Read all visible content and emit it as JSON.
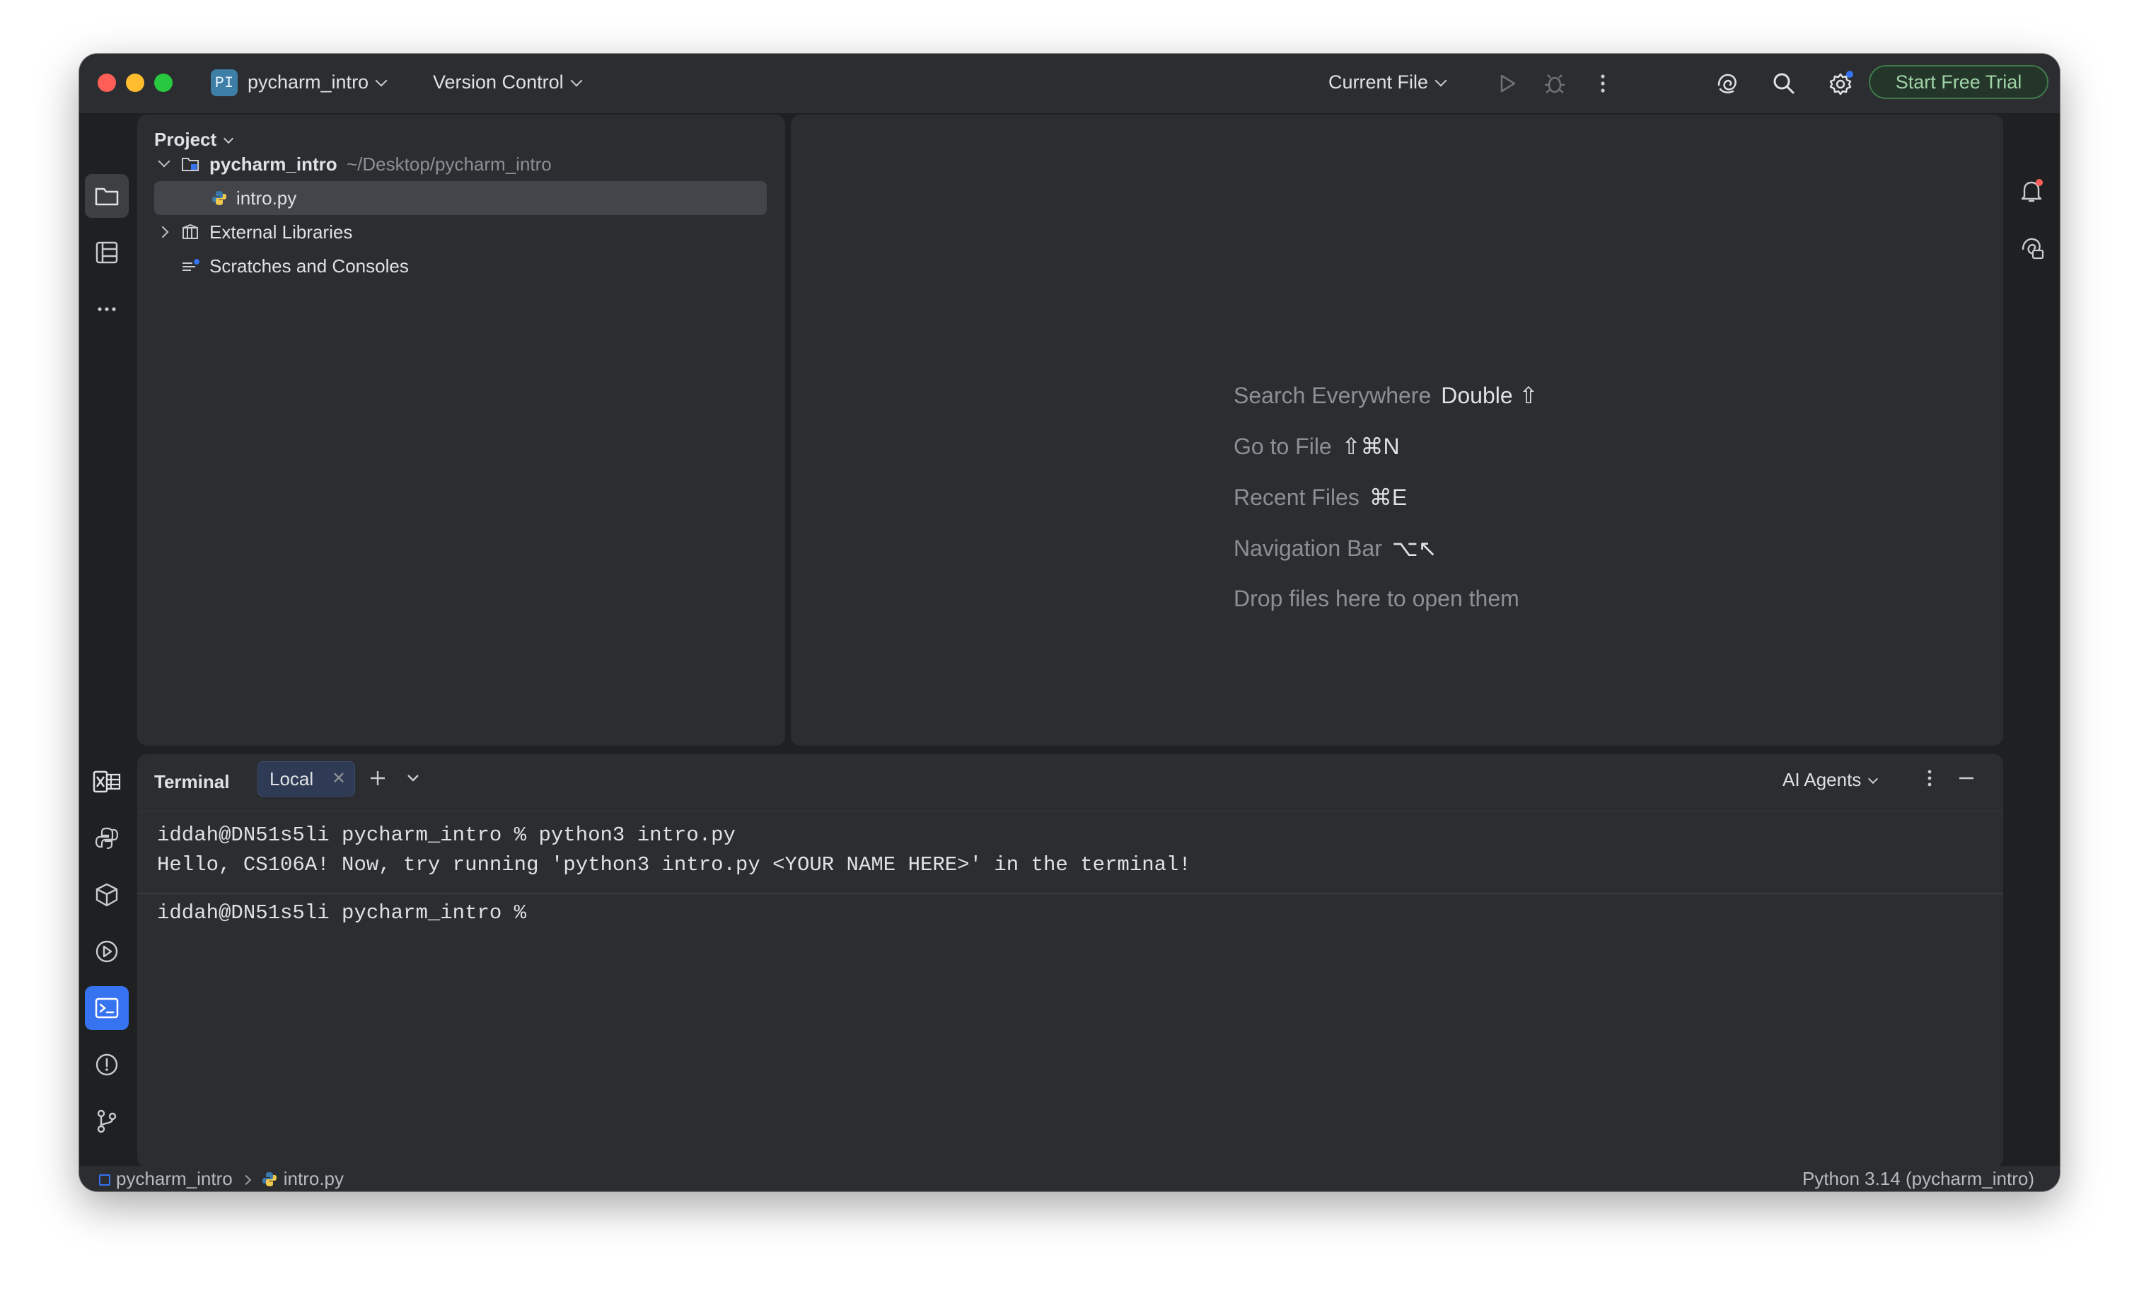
{
  "titlebar": {
    "project_badge": "PI",
    "project_name": "pycharm_intro",
    "vcs_label": "Version Control",
    "run_config": "Current File",
    "trial_button": "Start Free Trial"
  },
  "project_panel": {
    "title": "Project",
    "root": {
      "name": "pycharm_intro",
      "path": "~/Desktop/pycharm_intro"
    },
    "items": [
      {
        "label": "intro.py"
      },
      {
        "label": "External Libraries"
      },
      {
        "label": "Scratches and Consoles"
      }
    ]
  },
  "editor_hints": [
    {
      "label": "Search Everywhere",
      "shortcut": "Double ⇧"
    },
    {
      "label": "Go to File",
      "shortcut": "⇧⌘N"
    },
    {
      "label": "Recent Files",
      "shortcut": "⌘E"
    },
    {
      "label": "Navigation Bar",
      "shortcut": "⌥↖"
    },
    {
      "label": "Drop files here to open them",
      "shortcut": ""
    }
  ],
  "terminal": {
    "title": "Terminal",
    "tab": "Local",
    "ai_agents": "AI Agents",
    "lines": [
      "iddah@DN51s5li pycharm_intro % python3 intro.py",
      "Hello, CS106A! Now, try running 'python3 intro.py <YOUR NAME HERE>' in the terminal!"
    ],
    "prompt": "iddah@DN51s5li pycharm_intro % "
  },
  "statusbar": {
    "breadcrumb": [
      "pycharm_intro",
      "intro.py"
    ],
    "interpreter": "Python 3.14 (pycharm_intro)"
  },
  "colors": {
    "accent": "#3573f0",
    "trial_green": "#9fd4a7",
    "notification_dot": "#ff5f57"
  }
}
